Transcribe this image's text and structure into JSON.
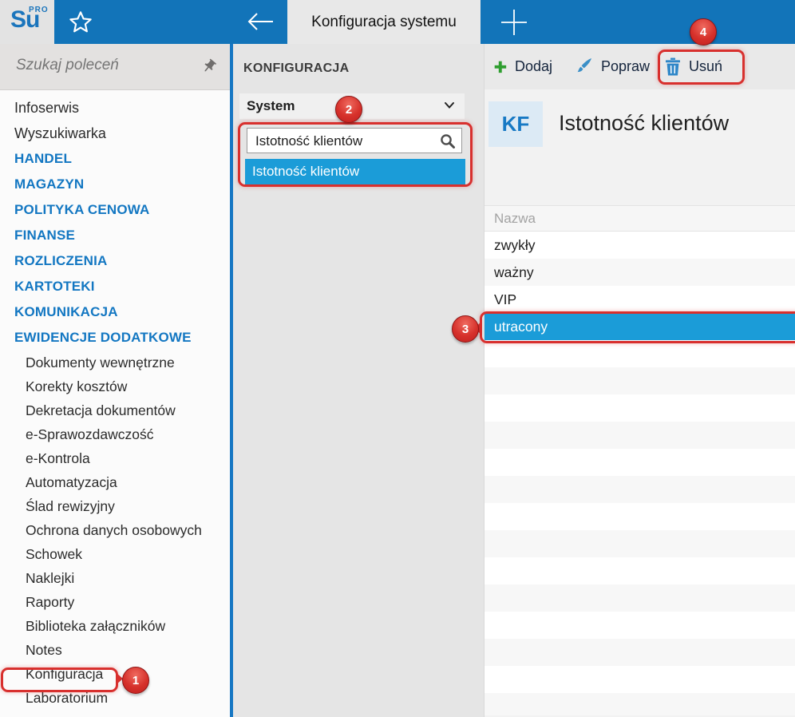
{
  "colors": {
    "topbar_blue": "#1274b9",
    "selection_blue": "#1b9cd8",
    "section_blue": "#1377c2",
    "annotation_red": "#d8302e",
    "add_green": "#2f9e30",
    "icon_blue": "#2f87c8"
  },
  "topbar": {
    "logo_text": "Su",
    "logo_sup": "PRO",
    "tab_title": "Konfiguracja systemu"
  },
  "sidebar": {
    "search_placeholder": "Szukaj poleceń",
    "items": [
      {
        "label": "Infoserwis",
        "style": "normal"
      },
      {
        "label": "Wyszukiwarka",
        "style": "normal"
      },
      {
        "label": "HANDEL",
        "style": "section"
      },
      {
        "label": "MAGAZYN",
        "style": "section"
      },
      {
        "label": "POLITYKA CENOWA",
        "style": "section"
      },
      {
        "label": "FINANSE",
        "style": "section"
      },
      {
        "label": "ROZLICZENIA",
        "style": "section"
      },
      {
        "label": "KARTOTEKI",
        "style": "section"
      },
      {
        "label": "KOMUNIKACJA",
        "style": "section"
      },
      {
        "label": "EWIDENCJE DODATKOWE",
        "style": "section"
      },
      {
        "label": "Dokumenty wewnętrzne",
        "style": "sub"
      },
      {
        "label": "Korekty kosztów",
        "style": "sub"
      },
      {
        "label": "Dekretacja dokumentów",
        "style": "sub"
      },
      {
        "label": "e-Sprawozdawczość",
        "style": "sub"
      },
      {
        "label": "e-Kontrola",
        "style": "sub"
      },
      {
        "label": "Automatyzacja",
        "style": "sub"
      },
      {
        "label": "Ślad rewizyjny",
        "style": "sub"
      },
      {
        "label": "Ochrona danych osobowych",
        "style": "sub"
      },
      {
        "label": "Schowek",
        "style": "sub"
      },
      {
        "label": "Naklejki",
        "style": "sub"
      },
      {
        "label": "Raporty",
        "style": "sub"
      },
      {
        "label": "Biblioteka załączników",
        "style": "sub"
      },
      {
        "label": "Notes",
        "style": "sub"
      },
      {
        "label": "Konfiguracja",
        "style": "sub"
      },
      {
        "label": "Laboratorium",
        "style": "sub"
      }
    ]
  },
  "config_panel": {
    "header": "KONFIGURACJA",
    "category_value": "System",
    "filter_value": "Istotność klientów",
    "result_item": "Istotność klientów"
  },
  "toolbar": {
    "add_label": "Dodaj",
    "edit_label": "Popraw",
    "delete_label": "Usuń"
  },
  "main": {
    "badge_text": "KF",
    "page_title": "Istotność klientów",
    "table": {
      "header": "Nazwa",
      "rows": [
        "zwykły",
        "ważny",
        "VIP",
        "utracony"
      ],
      "selected_row": "utracony"
    }
  },
  "annotations": {
    "step1": "1",
    "step2": "2",
    "step3": "3",
    "step4": "4"
  }
}
